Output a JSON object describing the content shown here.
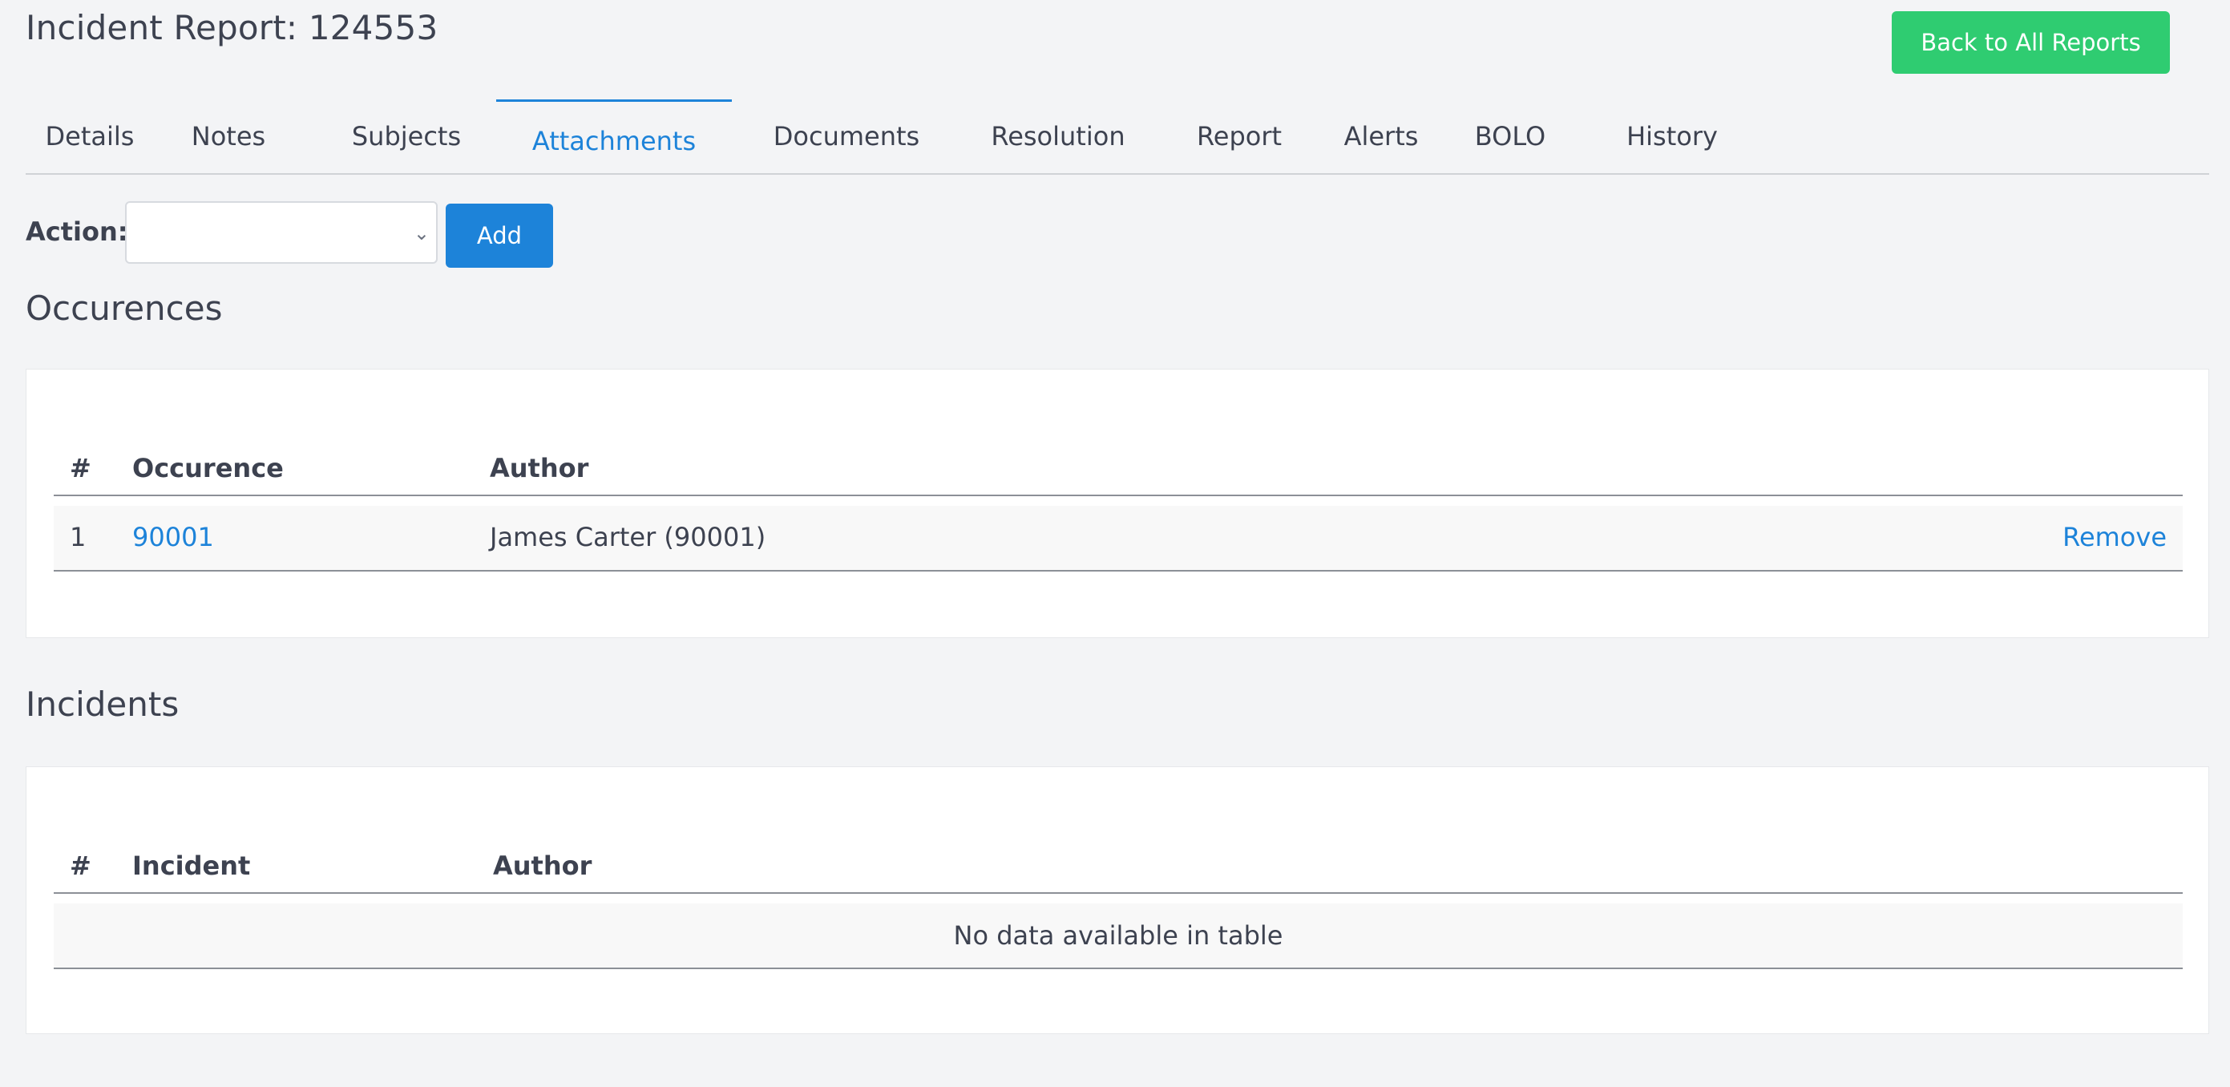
{
  "header": {
    "title": "Incident Report: 124553",
    "back_button": "Back to All Reports"
  },
  "tabs": [
    {
      "label": "Details",
      "active": false
    },
    {
      "label": "Notes",
      "active": false
    },
    {
      "label": "Subjects",
      "active": false
    },
    {
      "label": "Attachments",
      "active": true
    },
    {
      "label": "Documents",
      "active": false
    },
    {
      "label": "Resolution",
      "active": false
    },
    {
      "label": "Report",
      "active": false
    },
    {
      "label": "Alerts",
      "active": false
    },
    {
      "label": "BOLO",
      "active": false
    },
    {
      "label": "History",
      "active": false
    }
  ],
  "action": {
    "label": "Action:",
    "selected_value": "",
    "add_button": "Add"
  },
  "occurences": {
    "title": "Occurences",
    "columns": [
      "#",
      "Occurence",
      "Author"
    ],
    "rows": [
      {
        "num": "1",
        "occurence": "90001",
        "author": "James Carter (90001)",
        "action": "Remove"
      }
    ]
  },
  "incidents": {
    "title": "Incidents",
    "columns": [
      "#",
      "Incident",
      "Author"
    ],
    "empty_message": "No data available in table"
  },
  "colors": {
    "accent": "#1d83d9",
    "success": "#2fcc71",
    "text": "#3d4250",
    "background": "#f3f4f6"
  },
  "icons": {
    "select_arrow": "chevron-down-icon"
  }
}
